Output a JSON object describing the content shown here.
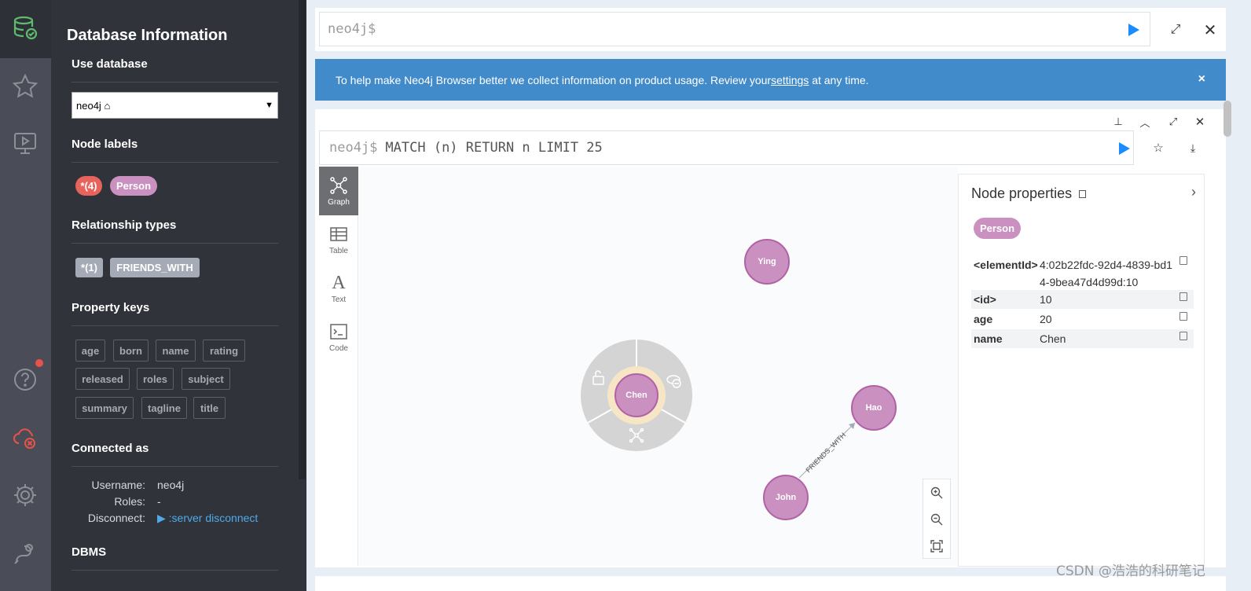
{
  "rail": {
    "icons": [
      "database-icon",
      "star-icon",
      "play-tutorial-icon",
      "help-icon",
      "disconnected-cloud-icon",
      "gear-icon",
      "plug-icon"
    ]
  },
  "drawer": {
    "title": "Database Information",
    "use_database": {
      "heading": "Use database",
      "selected": "neo4j"
    },
    "node_labels": {
      "heading": "Node labels",
      "items": [
        "*(4)",
        "Person"
      ]
    },
    "relationship_types": {
      "heading": "Relationship types",
      "items": [
        "*(1)",
        "FRIENDS_WITH"
      ]
    },
    "property_keys": {
      "heading": "Property keys",
      "items": [
        "age",
        "born",
        "name",
        "rating",
        "released",
        "roles",
        "subject",
        "summary",
        "tagline",
        "title"
      ]
    },
    "connected_as": {
      "heading": "Connected as",
      "username_label": "Username:",
      "username": "neo4j",
      "roles_label": "Roles:",
      "roles": "-",
      "disconnect_label": "Disconnect:",
      "disconnect_link": ":server disconnect"
    },
    "dbms": {
      "heading": "DBMS"
    }
  },
  "editor": {
    "prompt": "neo4j$"
  },
  "banner": {
    "text_before": "To help make Neo4j Browser better we collect information on product usage. Review your ",
    "link": "settings",
    "text_after": " at any time.",
    "close": "×"
  },
  "frame": {
    "prompt": "neo4j$",
    "query": "MATCH (n) RETURN n LIMIT 25",
    "views": [
      {
        "label": "Graph",
        "active": true
      },
      {
        "label": "Table",
        "active": false
      },
      {
        "label": "Text",
        "active": false
      },
      {
        "label": "Code",
        "active": false
      }
    ],
    "graph": {
      "nodes": [
        "Ying",
        "Chen",
        "Hao",
        "John"
      ],
      "relationship": {
        "from": "John",
        "to": "Hao",
        "type": "FRIENDS_WITH"
      },
      "selected": "Chen"
    },
    "properties": {
      "title": "Node properties",
      "label": "Person",
      "rows": [
        {
          "key": "<elementId>",
          "value": "4:02b22fdc-92d4-4839-bd14-9bea47d4d99d:10"
        },
        {
          "key": "<id>",
          "value": "10"
        },
        {
          "key": "age",
          "value": "20"
        },
        {
          "key": "name",
          "value": "Chen"
        }
      ]
    }
  },
  "watermark": "CSDN @浩浩的科研笔记",
  "colors": {
    "accent": "#428bca",
    "person": "#c990c0",
    "play": "#1a8cff",
    "drawer": "#31333b"
  }
}
